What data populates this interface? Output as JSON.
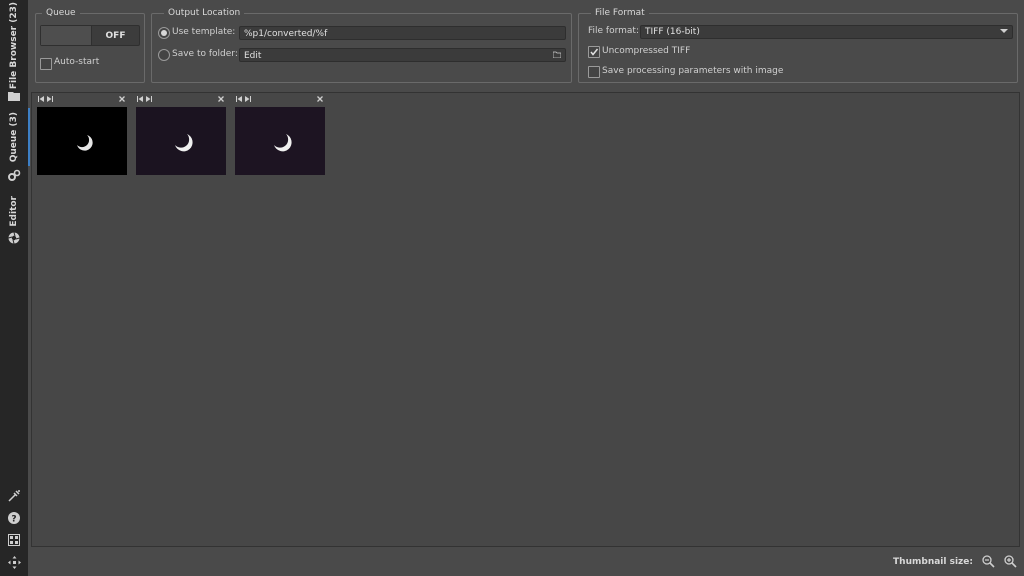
{
  "sidebar": {
    "tabs": [
      {
        "label": "File Browser (23)",
        "icon": "folder-icon"
      },
      {
        "label": "Queue (3)",
        "icon": "gears-icon"
      },
      {
        "label": "Editor",
        "icon": "aperture-icon"
      }
    ],
    "bottom_icons": [
      "color-picker-icon",
      "help-icon",
      "screen-layout-icon",
      "fullscreen-icon"
    ]
  },
  "queue": {
    "title": "Queue",
    "toggle_label": "OFF",
    "autostart_label": "Auto-start",
    "autostart_checked": false
  },
  "output_location": {
    "title": "Output Location",
    "use_template_label": "Use template:",
    "template_value": "%p1/converted/%f",
    "save_to_folder_label": "Save to folder:",
    "folder_value": "Edit",
    "selected": "use_template"
  },
  "file_format": {
    "title": "File Format",
    "format_label": "File format:",
    "format_value": "TIFF (16-bit)",
    "uncompressed_label": "Uncompressed TIFF",
    "uncompressed_checked": true,
    "save_params_label": "Save processing parameters with image",
    "save_params_checked": false
  },
  "thumbnails": [
    {
      "background": "#000000",
      "tint": "none"
    },
    {
      "background": "#1b1320",
      "tint": "purple"
    },
    {
      "background": "#1d1422",
      "tint": "purple"
    }
  ],
  "footer": {
    "thumbnail_size_label": "Thumbnail size:",
    "zoom_out_icon": "zoom-out-icon",
    "zoom_in_icon": "zoom-in-icon"
  },
  "colors": {
    "sidebar_bg": "#262626",
    "panel_bg": "#4a4a4a",
    "accent": "#3d80c6"
  }
}
